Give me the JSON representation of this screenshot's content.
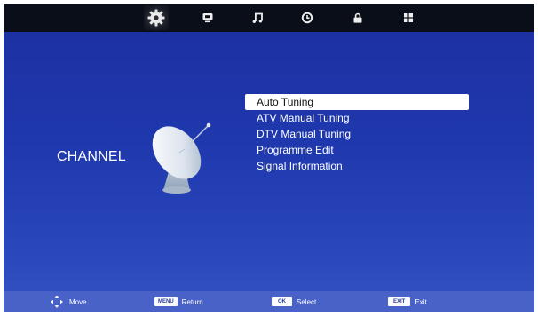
{
  "topbar": {
    "tabs": [
      {
        "icon": "gear-icon",
        "active": true
      },
      {
        "icon": "monitor-icon",
        "active": false
      },
      {
        "icon": "music-note-icon",
        "active": false
      },
      {
        "icon": "clock-icon",
        "active": false
      },
      {
        "icon": "lock-icon",
        "active": false
      },
      {
        "icon": "grid-icon",
        "active": false
      }
    ]
  },
  "page": {
    "title": "CHANNEL",
    "illustration": "satellite-dish-icon"
  },
  "menu": {
    "items": [
      "Auto Tuning",
      "ATV Manual Tuning",
      "DTV Manual Tuning",
      "Programme Edit",
      "Signal Information"
    ],
    "selected_index": 0
  },
  "footer": {
    "move": {
      "icon": "move-arrows-icon",
      "label": "Move"
    },
    "return": {
      "key": "MENU",
      "label": "Return"
    },
    "select": {
      "key": "OK",
      "label": "Select"
    },
    "exit": {
      "key": "EXIT",
      "label": "Exit"
    }
  },
  "colors": {
    "background": "#1f38ad",
    "topbar": "#0a0e18",
    "bottombar": "#4862c8",
    "highlight": "#ffffff"
  }
}
